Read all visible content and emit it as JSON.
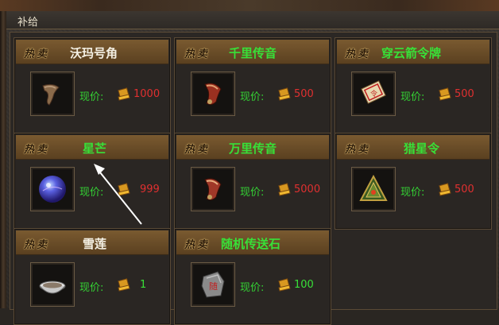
{
  "window": {
    "title": "补给"
  },
  "hot_label": "热卖",
  "price_label": "现价:",
  "items": [
    {
      "name": "沃玛号角",
      "price": "1000",
      "name_color": "white",
      "price_color": "red",
      "icon": "horn-icon"
    },
    {
      "name": "千里传音",
      "price": "500",
      "name_color": "green",
      "price_color": "red",
      "icon": "horn-icon"
    },
    {
      "name": "穿云箭令牌",
      "price": "500",
      "name_color": "green",
      "price_color": "red",
      "icon": "token-card-icon"
    },
    {
      "name": "星芒",
      "price": "999",
      "name_color": "green",
      "price_color": "red",
      "icon": "star-orb-icon"
    },
    {
      "name": "万里传音",
      "price": "5000",
      "name_color": "green",
      "price_color": "red",
      "icon": "horn-icon"
    },
    {
      "name": "猎星令",
      "price": "500",
      "name_color": "green",
      "price_color": "red",
      "icon": "triangle-token-icon"
    },
    {
      "name": "雪莲",
      "price": "1",
      "name_color": "white",
      "price_color": "green",
      "icon": "lotus-bowl-icon"
    },
    {
      "name": "随机传送石",
      "price": "100",
      "name_color": "green",
      "price_color": "green",
      "icon": "teleport-stone-icon"
    }
  ]
}
